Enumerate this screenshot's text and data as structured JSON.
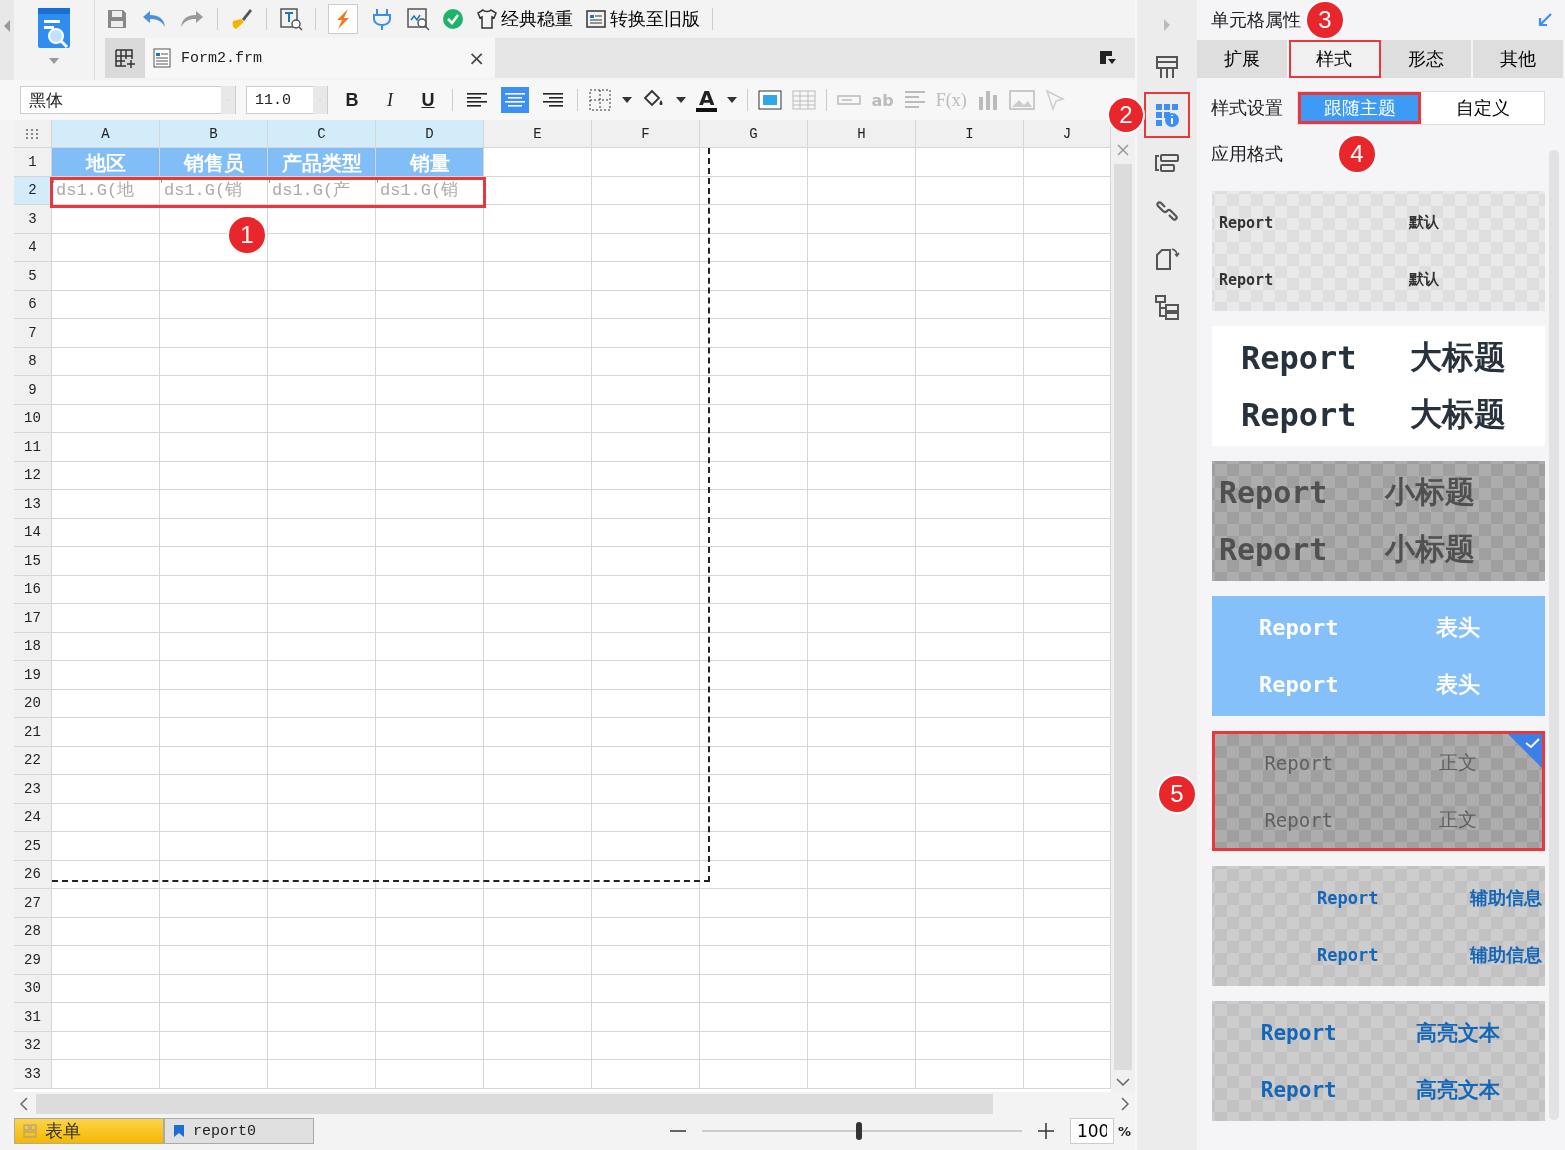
{
  "toolbar": {
    "theme_button": "经典稳重",
    "legacy_button": "转换至旧版"
  },
  "file_tab": {
    "label": "Form2.frm",
    "close": "×"
  },
  "format_bar": {
    "font": "黑体",
    "size": "11.0",
    "style_buttons": [
      "B",
      "I",
      "U"
    ],
    "alignment": [
      {
        "selected": false
      },
      {
        "selected": true
      },
      {
        "selected": false
      }
    ],
    "font_color_glyph": "A",
    "disabled_glyphs": [
      "ab",
      "F(x)"
    ]
  },
  "sheet": {
    "columns": [
      {
        "label": "A",
        "selected": true
      },
      {
        "label": "B",
        "selected": true
      },
      {
        "label": "C",
        "selected": true
      },
      {
        "label": "D",
        "selected": true
      },
      {
        "label": "E",
        "selected": false
      },
      {
        "label": "F",
        "selected": false
      },
      {
        "label": "G",
        "selected": false
      },
      {
        "label": "H",
        "selected": false
      },
      {
        "label": "I",
        "selected": false
      },
      {
        "label": "J",
        "selected": false
      }
    ],
    "rows": [
      {
        "label": "1",
        "kind": "header",
        "selected": false,
        "cells": [
          "地区",
          "销售员",
          "产品类型",
          "销量"
        ]
      },
      {
        "label": "2",
        "kind": "data",
        "selected": true,
        "highlighted": true,
        "badge": "1",
        "cells": [
          "ds1.G(地",
          "ds1.G(销",
          "ds1.G(产",
          "ds1.G(销"
        ]
      },
      {
        "label": "3"
      },
      {
        "label": "4"
      },
      {
        "label": "5"
      },
      {
        "label": "6"
      },
      {
        "label": "7"
      },
      {
        "label": "8"
      },
      {
        "label": "9"
      },
      {
        "label": "10"
      },
      {
        "label": "11"
      },
      {
        "label": "12"
      },
      {
        "label": "13"
      },
      {
        "label": "14"
      },
      {
        "label": "15"
      },
      {
        "label": "16"
      },
      {
        "label": "17"
      },
      {
        "label": "18"
      },
      {
        "label": "19"
      },
      {
        "label": "20"
      },
      {
        "label": "21"
      },
      {
        "label": "22"
      },
      {
        "label": "23"
      },
      {
        "label": "24"
      },
      {
        "label": "25"
      },
      {
        "label": "26"
      },
      {
        "label": "27"
      },
      {
        "label": "28"
      },
      {
        "label": "29"
      },
      {
        "label": "30"
      },
      {
        "label": "31"
      },
      {
        "label": "32"
      },
      {
        "label": "33"
      }
    ]
  },
  "sheet_tabs": [
    {
      "label": "表单",
      "selected": true
    },
    {
      "label": "report0",
      "selected": false
    }
  ],
  "zoom": {
    "level": 0.49,
    "value": "100",
    "unit": "%"
  },
  "side_tabs": [
    {
      "selected": false,
      "highlighted": false
    },
    {
      "selected": true,
      "highlighted": true,
      "badge": "2"
    },
    {
      "selected": false,
      "highlighted": false
    },
    {
      "selected": false,
      "highlighted": false
    },
    {
      "selected": false,
      "highlighted": false
    },
    {
      "selected": false,
      "highlighted": false
    }
  ],
  "panel": {
    "title": "单元格属性",
    "title_badge": "3",
    "tabs": [
      {
        "label": "扩展",
        "selected": false,
        "highlighted": false
      },
      {
        "label": "样式",
        "selected": true,
        "highlighted": true
      },
      {
        "label": "形态",
        "selected": false,
        "highlighted": false
      },
      {
        "label": "其他",
        "selected": false,
        "highlighted": false
      }
    ],
    "style_setting": {
      "label": "样式设置",
      "options": [
        {
          "label": "跟随主题",
          "selected": true,
          "highlighted": true
        },
        {
          "label": "自定义",
          "selected": false,
          "highlighted": false
        }
      ]
    },
    "apply_label": "应用格式",
    "apply_badge": "4",
    "styles": [
      {
        "kind": "default",
        "selected": false,
        "highlighted": false,
        "rows": [
          [
            "Report",
            "默认"
          ],
          [
            "Report",
            "默认"
          ]
        ]
      },
      {
        "kind": "big_title",
        "selected": false,
        "highlighted": false,
        "rows": [
          [
            "Report",
            "大标题"
          ],
          [
            "Report",
            "大标题"
          ]
        ]
      },
      {
        "kind": "sub_title",
        "selected": false,
        "highlighted": false,
        "rows": [
          [
            "Report",
            "小标题"
          ],
          [
            "Report",
            "小标题"
          ]
        ]
      },
      {
        "kind": "header",
        "selected": false,
        "highlighted": false,
        "rows": [
          [
            "Report",
            "表头"
          ],
          [
            "Report",
            "表头"
          ]
        ]
      },
      {
        "kind": "body",
        "selected": true,
        "highlighted": true,
        "badge": "5",
        "rows": [
          [
            "Report",
            "正文"
          ],
          [
            "Report",
            "正文"
          ]
        ]
      },
      {
        "kind": "aux",
        "selected": false,
        "highlighted": false,
        "rows": [
          [
            "Report",
            "辅助信息"
          ],
          [
            "Report",
            "辅助信息"
          ]
        ]
      },
      {
        "kind": "highlight",
        "selected": false,
        "highlighted": false,
        "rows": [
          [
            "Report",
            "高亮文本"
          ],
          [
            "Report",
            "高亮文本"
          ]
        ]
      }
    ]
  }
}
